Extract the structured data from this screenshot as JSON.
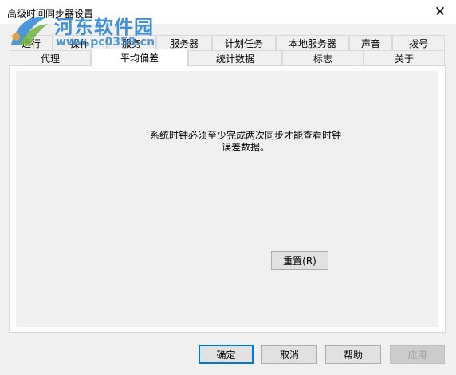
{
  "window": {
    "title": "高级时间同步器设置",
    "close_glyph": "✕"
  },
  "watermark": {
    "name": "河东软件园",
    "url": "www.pc0359.cn"
  },
  "tabs_row1": [
    {
      "label": "运行"
    },
    {
      "label": "操作"
    },
    {
      "label": "服务"
    },
    {
      "label": "服务器"
    },
    {
      "label": "计划任务"
    },
    {
      "label": "本地服务器"
    },
    {
      "label": "声音"
    },
    {
      "label": "拨号"
    }
  ],
  "tabs_row2": [
    {
      "label": "代理"
    },
    {
      "label": "平均偏差",
      "active": true
    },
    {
      "label": "统计数据"
    },
    {
      "label": "标志"
    },
    {
      "label": "关于"
    }
  ],
  "panel": {
    "message_line1": "系统时钟必须至少完成两次同步才能查看时钟",
    "message_line2": "误差数据。",
    "reset_button": "重置(R)"
  },
  "footer": {
    "ok": "确定",
    "cancel": "取消",
    "help": "帮助",
    "apply": "应用"
  },
  "colors": {
    "accent": "#0078d7",
    "watermark": "#2f86d6"
  }
}
